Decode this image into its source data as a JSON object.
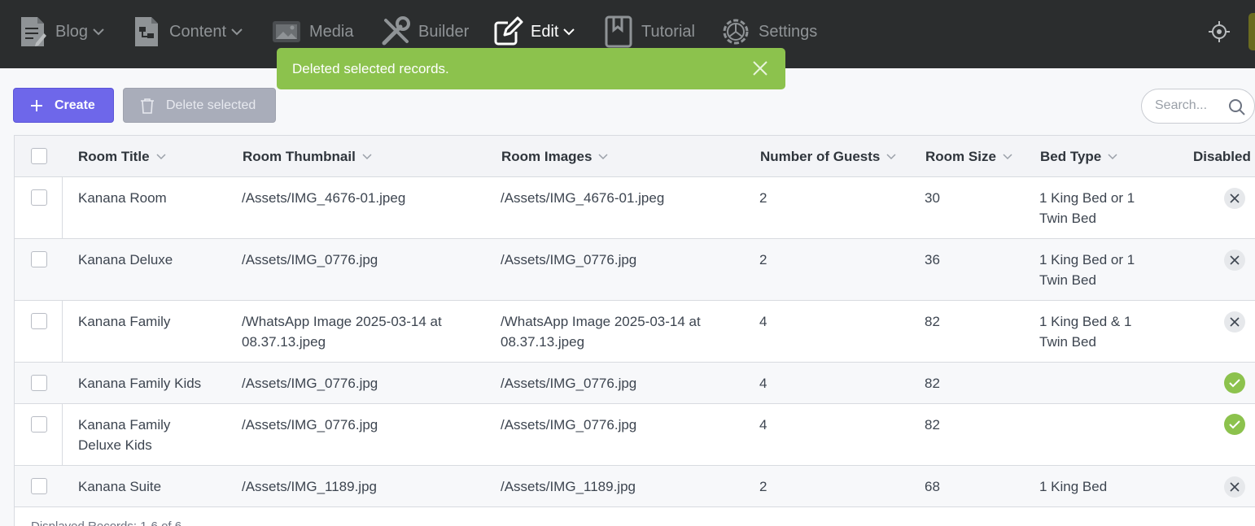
{
  "nav": {
    "items": [
      {
        "label": "Blog",
        "icon": "document-icon",
        "dropdown": true
      },
      {
        "label": "Content",
        "icon": "content-icon",
        "dropdown": true
      },
      {
        "label": "Media",
        "icon": "image-icon",
        "dropdown": false
      },
      {
        "label": "Builder",
        "icon": "tools-icon",
        "dropdown": false
      },
      {
        "label": "Edit",
        "icon": "edit-icon",
        "dropdown": true,
        "active": true
      },
      {
        "label": "Tutorial",
        "icon": "bookmark-icon",
        "dropdown": false
      },
      {
        "label": "Settings",
        "icon": "gear-icon",
        "dropdown": false
      }
    ],
    "right_icon": "locate-icon"
  },
  "toast": {
    "message": "Deleted selected records.",
    "color": "#8cc24d"
  },
  "toolbar": {
    "create_label": "Create",
    "delete_label": "Delete selected",
    "search_placeholder": "Search..."
  },
  "table": {
    "headers": [
      "Room Title",
      "Room Thumbnail",
      "Room Images",
      "Number of Guests",
      "Room Size",
      "Bed Type",
      "Disabled"
    ],
    "rows": [
      {
        "title": "Kanana Room",
        "thumbnail": "/Assets/IMG_4676-01.jpeg",
        "images": "/Assets/IMG_4676-01.jpeg",
        "guests": "2",
        "size": "30",
        "bed": "1 King Bed or 1 Twin Bed",
        "disabled": false
      },
      {
        "title": "Kanana Deluxe",
        "thumbnail": "/Assets/IMG_0776.jpg",
        "images": "/Assets/IMG_0776.jpg",
        "guests": "2",
        "size": "36",
        "bed": "1 King Bed or 1 Twin Bed",
        "disabled": false
      },
      {
        "title": "Kanana Family",
        "thumbnail": "/WhatsApp Image 2025-03-14 at 08.37.13.jpeg",
        "images": "/WhatsApp Image 2025-03-14 at 08.37.13.jpeg",
        "guests": "4",
        "size": "82",
        "bed": "1 King Bed & 1 Twin Bed",
        "disabled": false
      },
      {
        "title": "Kanana Family Kids",
        "thumbnail": "/Assets/IMG_0776.jpg",
        "images": "/Assets/IMG_0776.jpg",
        "guests": "4",
        "size": "82",
        "bed": "",
        "disabled": true
      },
      {
        "title": "Kanana Family Deluxe Kids",
        "thumbnail": "/Assets/IMG_0776.jpg",
        "images": "/Assets/IMG_0776.jpg",
        "guests": "4",
        "size": "82",
        "bed": "",
        "disabled": true
      },
      {
        "title": "Kanana Suite",
        "thumbnail": "/Assets/IMG_1189.jpg",
        "images": "/Assets/IMG_1189.jpg",
        "guests": "2",
        "size": "68",
        "bed": "1 King Bed",
        "disabled": false
      }
    ],
    "footer": "Displayed Records: 1-6 of 6"
  },
  "colors": {
    "nav_bg": "#2b2d2e",
    "primary": "#6e67ea",
    "success": "#8cc24d"
  }
}
